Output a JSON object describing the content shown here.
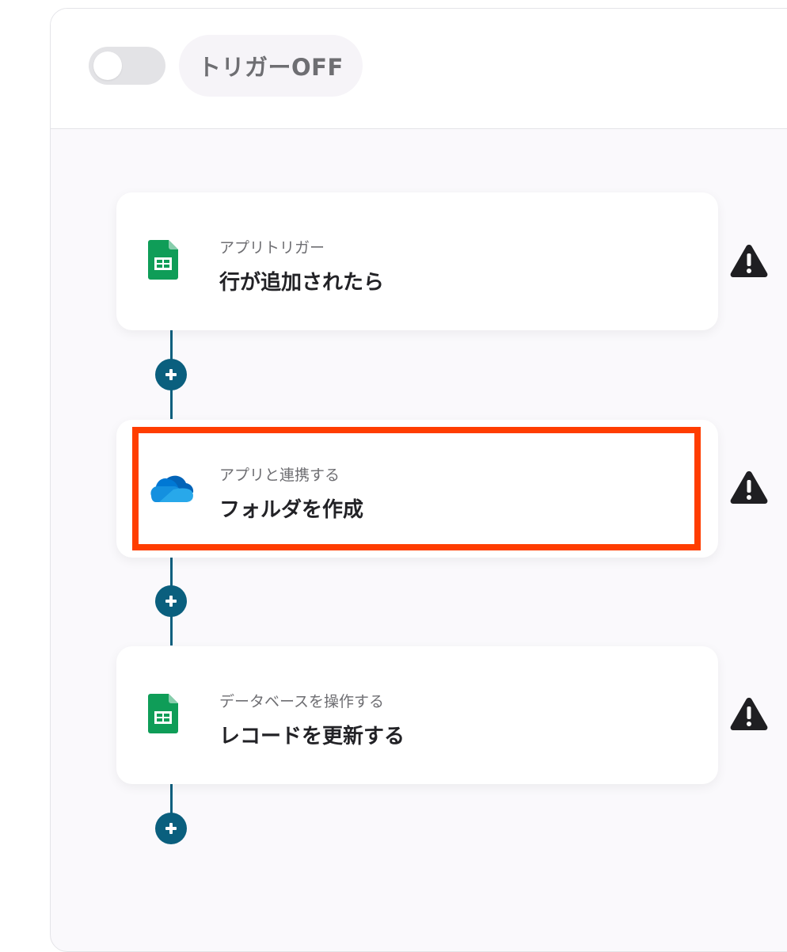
{
  "header": {
    "trigger_toggle_on": false,
    "trigger_status_label": "トリガーOFF"
  },
  "flow": {
    "steps": [
      {
        "category": "アプリトリガー",
        "title": "行が追加されたら",
        "app_icon": "google-sheets-icon",
        "warning_icon": "warning-triangle-icon"
      },
      {
        "category": "アプリと連携する",
        "title": "フォルダを作成",
        "app_icon": "onedrive-icon",
        "warning_icon": "warning-triangle-icon",
        "highlighted": true
      },
      {
        "category": "データベースを操作する",
        "title": "レコードを更新する",
        "app_icon": "google-sheets-icon",
        "warning_icon": "warning-triangle-icon"
      }
    ],
    "add_step_icon": "plus-icon"
  },
  "colors": {
    "connector": "#0a5f7e",
    "highlight_border": "#ff3d00",
    "sheets_green": "#0f9d58",
    "onedrive_blue": "#0364b8"
  }
}
